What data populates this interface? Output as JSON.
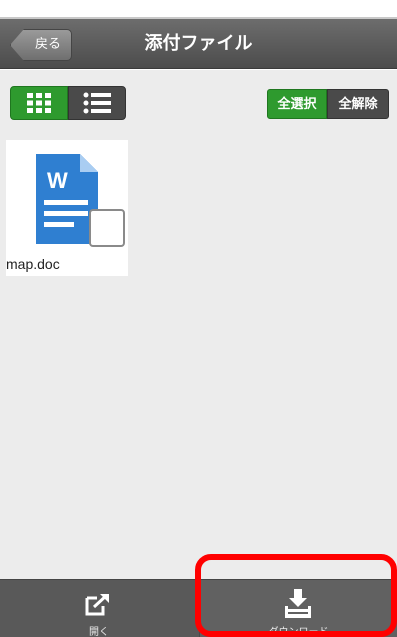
{
  "header": {
    "back_label": "戻る",
    "title": "添付ファイル"
  },
  "view_toggle": {
    "grid_icon": "grid-icon",
    "list_icon": "list-icon",
    "active": "grid"
  },
  "selection": {
    "select_all_label": "全選択",
    "deselect_all_label": "全解除"
  },
  "files": [
    {
      "name": "map.doc",
      "icon": "word-document-icon",
      "icon_letter": "W",
      "checked": false
    }
  ],
  "toolbar": {
    "open_label": "開く",
    "open_icon": "open-external-icon",
    "download_label": "ダウンロード",
    "download_icon": "download-icon"
  },
  "colors": {
    "accent_green": "#2e9a2e",
    "header_gray": "#5a5a5a",
    "word_blue": "#2f7fd1",
    "highlight_red": "#ff0000"
  }
}
